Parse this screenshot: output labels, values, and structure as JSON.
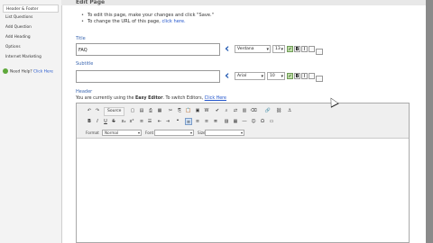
{
  "sidebar": {
    "items": [
      {
        "label": "Header & Footer",
        "active": true
      },
      {
        "label": "List Questions",
        "active": false
      },
      {
        "label": "Add Question",
        "active": false
      },
      {
        "label": "Add Heading",
        "active": false
      },
      {
        "label": "Options",
        "active": false
      },
      {
        "label": "Internet Marketing",
        "active": false
      }
    ],
    "help_text": "Need Help?",
    "help_link": "Click Here"
  },
  "page_title": "Edit Page",
  "instructions": {
    "line1": "To edit this page, make your changes and click \"Save.\"",
    "line2_text": "To change the URL of this page, ",
    "line2_link": "click here."
  },
  "title_section": {
    "label": "Title",
    "value": "FAQ",
    "font": "Verdana",
    "size": "13"
  },
  "subtitle_section": {
    "label": "Subtitle",
    "value": "",
    "font": "Arial",
    "size": "10"
  },
  "header_section": {
    "label": "Header",
    "note_prefix": "You are currently using the ",
    "note_mode": "Easy Editor",
    "note_mid": ". To switch Editors, ",
    "note_link": "Click Here"
  },
  "editor": {
    "source_label": "Source",
    "format_label": "Format",
    "format_value": "Normal",
    "font_label": "Font",
    "font_value": "",
    "size_label": "Size",
    "size_value": ""
  },
  "colors": {
    "accent": "#3a66b0",
    "link": "#2255cc",
    "sidebar_bg": "#f3f3f3",
    "toggle_on": "#bfe0a7"
  }
}
